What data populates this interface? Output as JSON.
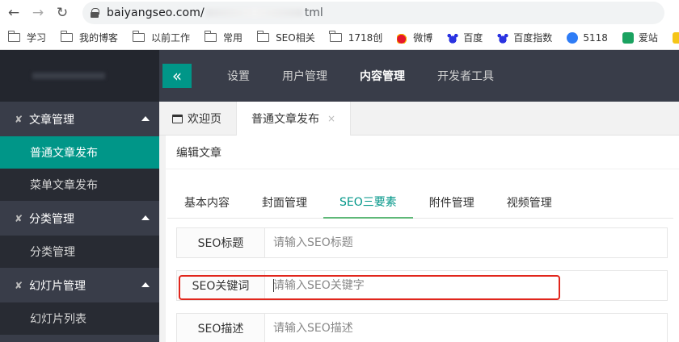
{
  "browser": {
    "url_host": "baiyangseo.com/",
    "url_suffix": "tml",
    "bookmarks": [
      {
        "label": "学习",
        "icon": "folder-icon"
      },
      {
        "label": "我的博客",
        "icon": "folder-icon"
      },
      {
        "label": "以前工作",
        "icon": "folder-icon"
      },
      {
        "label": "常用",
        "icon": "folder-icon"
      },
      {
        "label": "SEO相关",
        "icon": "folder-icon"
      },
      {
        "label": "1718创",
        "icon": "folder-icon"
      },
      {
        "label": "微博",
        "icon": "weibo-icon"
      },
      {
        "label": "百度",
        "icon": "baidu-icon"
      },
      {
        "label": "百度指数",
        "icon": "baidu-icon"
      },
      {
        "label": "5118",
        "icon": "5118-icon"
      },
      {
        "label": "爱站",
        "icon": "aizhan-icon"
      }
    ]
  },
  "topnav": {
    "collapse_icon": "«",
    "items": [
      "设置",
      "用户管理",
      "内容管理",
      "开发者工具"
    ],
    "active": "内容管理"
  },
  "sidebar": {
    "groups": [
      {
        "label": "文章管理",
        "items": [
          "普通文章发布",
          "菜单文章发布"
        ]
      },
      {
        "label": "分类管理",
        "items": [
          "分类管理"
        ]
      },
      {
        "label": "幻灯片管理",
        "items": [
          "幻灯片列表"
        ]
      }
    ],
    "active_item": "普通文章发布"
  },
  "tabs": {
    "home": "欢迎页",
    "current": "普通文章发布",
    "close": "×"
  },
  "editor": {
    "title": "编辑文章",
    "subtabs": [
      "基本内容",
      "封面管理",
      "SEO三要素",
      "附件管理",
      "视频管理"
    ],
    "active_subtab": "SEO三要素",
    "fields": [
      {
        "label": "SEO标题",
        "placeholder": "请输入SEO标题",
        "value": ""
      },
      {
        "label": "SEO关键词",
        "placeholder": "请输入SEO关键字",
        "value": ""
      },
      {
        "label": "SEO描述",
        "placeholder": "请输入SEO描述",
        "value": ""
      }
    ]
  },
  "colors": {
    "accent": "#009688",
    "sidebar_bg": "#393d49",
    "highlight": "#e1261c"
  }
}
